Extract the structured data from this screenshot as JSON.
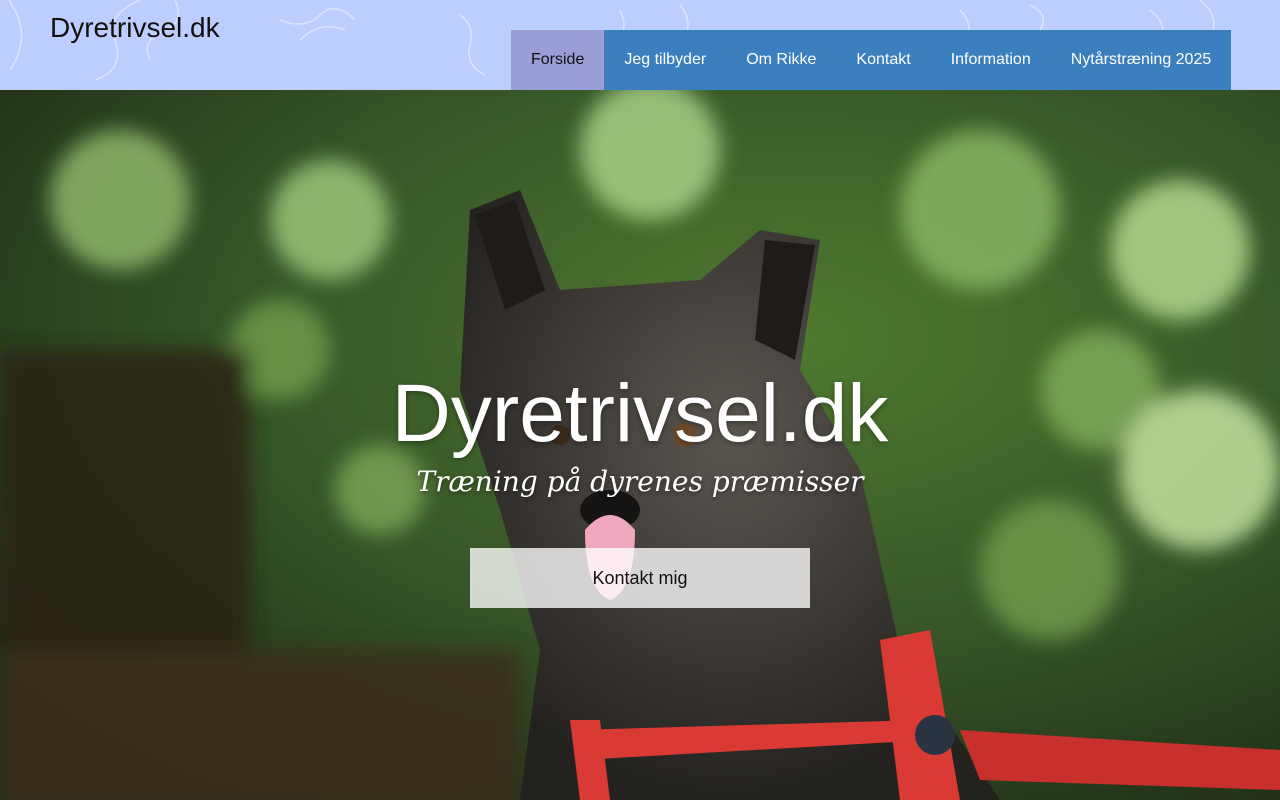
{
  "header": {
    "logo": "Dyretrivsel.dk",
    "background_color": "#bccefe"
  },
  "nav": {
    "background_color": "#3b7fbf",
    "active_color": "#9a9dd6",
    "items": [
      {
        "label": "Forside",
        "active": true
      },
      {
        "label": "Jeg tilbyder",
        "active": false
      },
      {
        "label": "Om Rikke",
        "active": false
      },
      {
        "label": "Kontakt",
        "active": false
      },
      {
        "label": "Information",
        "active": false
      },
      {
        "label": "Nytårstræning 2025",
        "active": false
      }
    ]
  },
  "hero": {
    "title": "Dyretrivsel.dk",
    "subtitle": "Træning på dyrenes præmisser",
    "cta_label": "Kontakt mig",
    "image": "dog-photo"
  }
}
